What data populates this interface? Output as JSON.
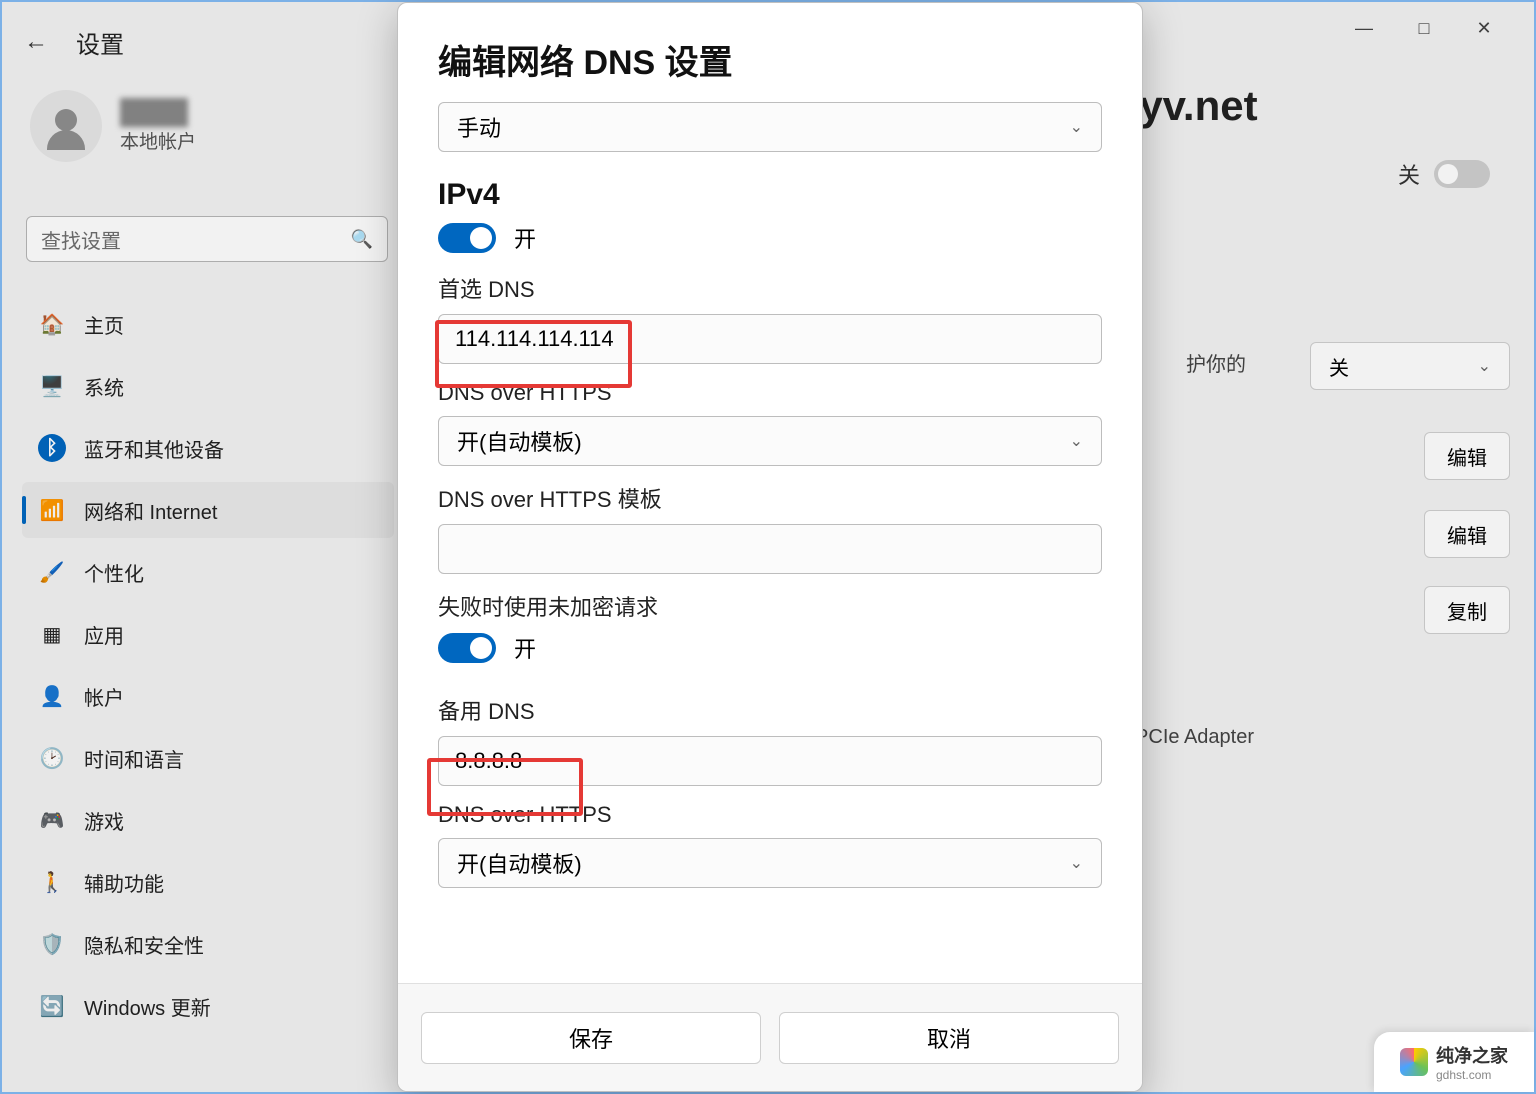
{
  "titlebar": {
    "minimize": "—",
    "maximize": "□",
    "close": "✕"
  },
  "header": {
    "app_title": "设置"
  },
  "user": {
    "name": "████",
    "subtitle": "本地帐户"
  },
  "search": {
    "placeholder": "查找设置"
  },
  "sidebar": {
    "items": [
      {
        "icon": "🏠",
        "label": "主页"
      },
      {
        "icon": "🖥️",
        "label": "系统"
      },
      {
        "icon": "ᛒ",
        "label": "蓝牙和其他设备"
      },
      {
        "icon": "📶",
        "label": "网络和 Internet",
        "selected": true
      },
      {
        "icon": "🖌️",
        "label": "个性化"
      },
      {
        "icon": "▦",
        "label": "应用"
      },
      {
        "icon": "👤",
        "label": "帐户"
      },
      {
        "icon": "🕑",
        "label": "时间和语言"
      },
      {
        "icon": "🎮",
        "label": "游戏"
      },
      {
        "icon": "🚶",
        "label": "辅助功能"
      },
      {
        "icon": "🛡️",
        "label": "隐私和安全性"
      },
      {
        "icon": "🔄",
        "label": "Windows 更新"
      }
    ]
  },
  "background": {
    "breadcrumb_tail": "olyv.net",
    "toggle_off_label": "关",
    "desc_fragment": "护你的",
    "dropdown_off": "关",
    "btn_edit": "编辑",
    "btn_copy": "复制",
    "adapter_fragment": "PCIe Adapter"
  },
  "modal": {
    "title": "编辑网络 DNS 设置",
    "mode_select": "手动",
    "ipv4_heading": "IPv4",
    "ipv4_toggle": "开",
    "primary_dns_label": "首选 DNS",
    "primary_dns_value": "114.114.114.114",
    "doh1_label": "DNS over HTTPS",
    "doh1_value": "开(自动模板)",
    "doh_template_label": "DNS over HTTPS 模板",
    "doh_template_value": "",
    "fallback_label": "失败时使用未加密请求",
    "fallback_toggle": "开",
    "secondary_dns_label": "备用 DNS",
    "secondary_dns_value": "8.8.8.8",
    "doh2_label": "DNS over HTTPS",
    "doh2_value": "开(自动模板)",
    "save": "保存",
    "cancel": "取消"
  },
  "watermark": {
    "name": "纯净之家",
    "domain": "gdhst.com"
  }
}
